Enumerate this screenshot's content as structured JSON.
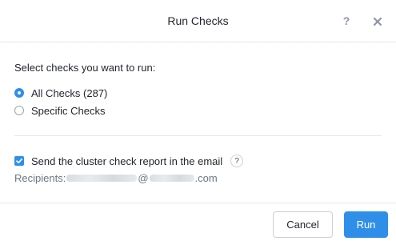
{
  "dialog": {
    "title": "Run Checks",
    "help_label": "?",
    "close_icon": "close-icon"
  },
  "body": {
    "prompt": "Select checks you want to run:",
    "options": [
      {
        "label": "All Checks (287)",
        "selected": true
      },
      {
        "label": "Specific Checks",
        "selected": false
      }
    ],
    "email": {
      "checked": true,
      "label": "Send the cluster check report in the email",
      "info_label": "?",
      "recipients_label": "Recipients:",
      "at_sign": "@",
      "domain_suffix": ".com"
    }
  },
  "footer": {
    "cancel_label": "Cancel",
    "run_label": "Run"
  },
  "colors": {
    "accent": "#2f8fe8",
    "border": "#e6e8eb",
    "muted_text": "#6b7785"
  }
}
